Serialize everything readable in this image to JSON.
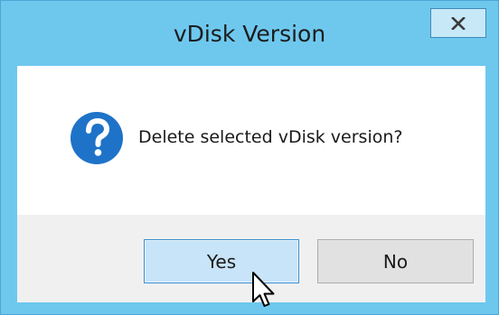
{
  "window": {
    "title": "vDisk Version",
    "close_label": "x"
  },
  "dialog": {
    "icon": "question-icon",
    "message": "Delete selected vDisk version?"
  },
  "buttons": {
    "yes_label": "Yes",
    "no_label": "No"
  },
  "colors": {
    "titlebar": "#6ec8ee",
    "icon_blue": "#1e73c8",
    "yes_focus_bg": "#c8e4f8",
    "yes_focus_border": "#3a8fd0"
  },
  "cursor": {
    "icon": "mouse-pointer-icon"
  }
}
